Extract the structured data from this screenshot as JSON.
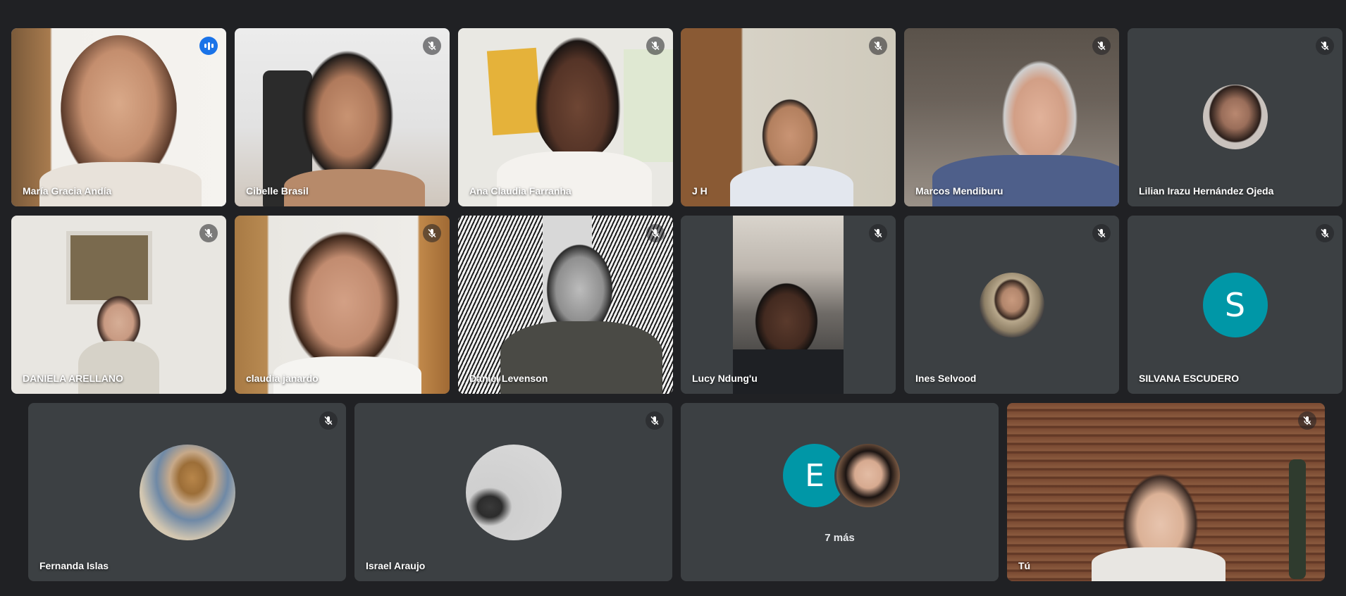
{
  "participants": [
    {
      "name": "María Gracia Andía",
      "speaking": true,
      "muted": false
    },
    {
      "name": "Cibelle Brasil",
      "muted": true
    },
    {
      "name": "Ana Claudia Farranha",
      "muted": true
    },
    {
      "name": "J H",
      "muted": true
    },
    {
      "name": "Marcos Mendiburu",
      "muted": true
    },
    {
      "name": "Lilian Irazu Hernández Ojeda",
      "muted": true
    },
    {
      "name": "DANIELA ARELLANO",
      "muted": true
    },
    {
      "name": "claudia janardo",
      "muted": true
    },
    {
      "name": "Daniel Levenson",
      "muted": true
    },
    {
      "name": "Lucy Ndung'u",
      "muted": true
    },
    {
      "name": "Ines Selvood",
      "muted": true
    },
    {
      "name": "SILVANA ESCUDERO",
      "muted": true,
      "initial": "S"
    },
    {
      "name": "Fernanda Islas",
      "muted": true
    },
    {
      "name": "Israel Araujo",
      "muted": true
    },
    {
      "name": "Tú",
      "muted": true
    }
  ],
  "overflow": {
    "initial": "E",
    "label": "7 más"
  },
  "colors": {
    "background": "#202124",
    "tile": "#3c4043",
    "active_border": "#8ab4f8",
    "speaking_badge": "#1a73e8",
    "letter_avatar": "#0097a7"
  }
}
